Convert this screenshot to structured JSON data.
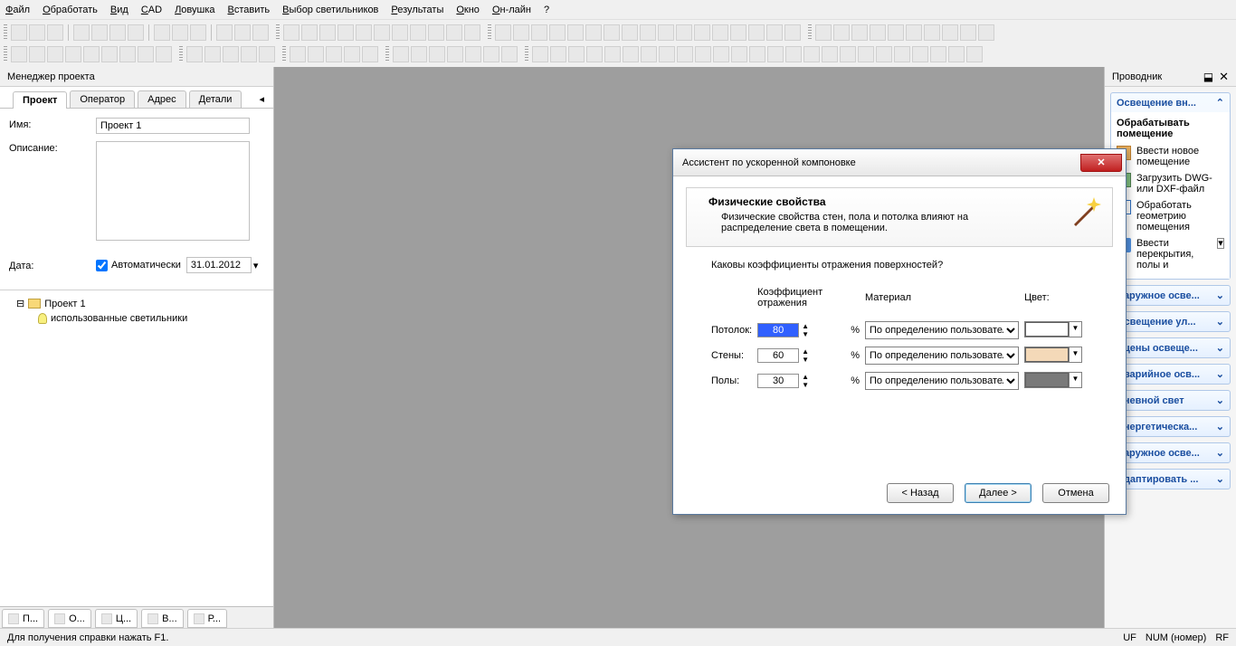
{
  "menu": [
    "Файл",
    "Обработать",
    "Вид",
    "CAD",
    "Ловушка",
    "Вставить",
    "Выбор светильников",
    "Результаты",
    "Окно",
    "Он-лайн",
    "?"
  ],
  "left_panel": {
    "title": "Менеджер проекта",
    "tabs": [
      "Проект",
      "Оператор",
      "Адрес",
      "Детали"
    ],
    "active_tab": 0,
    "name_label": "Имя:",
    "name_value": "Проект 1",
    "desc_label": "Описание:",
    "date_label": "Дата:",
    "auto_label": "Автоматически",
    "auto_checked": true,
    "date_value": "31.01.2012",
    "tree_root": "Проект 1",
    "tree_child": "использованные светильники",
    "bottom_tabs": [
      "П...",
      "О...",
      "Ц...",
      "В...",
      "Р..."
    ]
  },
  "right_panel": {
    "title": "Проводник",
    "sections": [
      {
        "label": "Освещение вн...",
        "expanded": true,
        "subheading": "Обрабатывать помещение",
        "items": [
          "Ввести новое помещение",
          "Загрузить DWG- или DXF-файл",
          "Обработать геометрию помещения",
          "Ввести перекрытия, полы и"
        ]
      },
      {
        "label": "Наружное осве...",
        "expanded": false
      },
      {
        "label": "Освещение ул...",
        "expanded": false
      },
      {
        "label": "Сцены освеще...",
        "expanded": false
      },
      {
        "label": "Аварийное осв...",
        "expanded": false
      },
      {
        "label": "Дневной свет",
        "expanded": false
      },
      {
        "label": "Энергетическа...",
        "expanded": false
      },
      {
        "label": "Наружное осве...",
        "expanded": false
      },
      {
        "label": "Адаптировать ...",
        "expanded": false
      }
    ]
  },
  "dialog": {
    "title": "Ассистент по ускоренной компоновке",
    "header_title": "Физические свойства",
    "header_desc": "Физические свойства стен, пола и потолка влияют на распределение света в помещении.",
    "question": "Каковы коэффициенты отражения поверхностей?",
    "col_coef": "Коэффициент отражения",
    "col_material": "Материал",
    "col_color": "Цвет:",
    "rows": [
      {
        "label": "Потолок:",
        "value": "80",
        "material": "По определению пользователя",
        "color": "#ffffff"
      },
      {
        "label": "Стены:",
        "value": "60",
        "material": "По определению пользователя",
        "color": "#f4d9b8"
      },
      {
        "label": "Полы:",
        "value": "30",
        "material": "По определению пользователя",
        "color": "#7a7a7a"
      }
    ],
    "pct": "%",
    "btn_back": "< Назад",
    "btn_next": "Далее >",
    "btn_cancel": "Отмена"
  },
  "statusbar": {
    "help": "Для получения справки нажать F1.",
    "right": [
      "UF",
      "NUM (номер)",
      "RF"
    ]
  }
}
